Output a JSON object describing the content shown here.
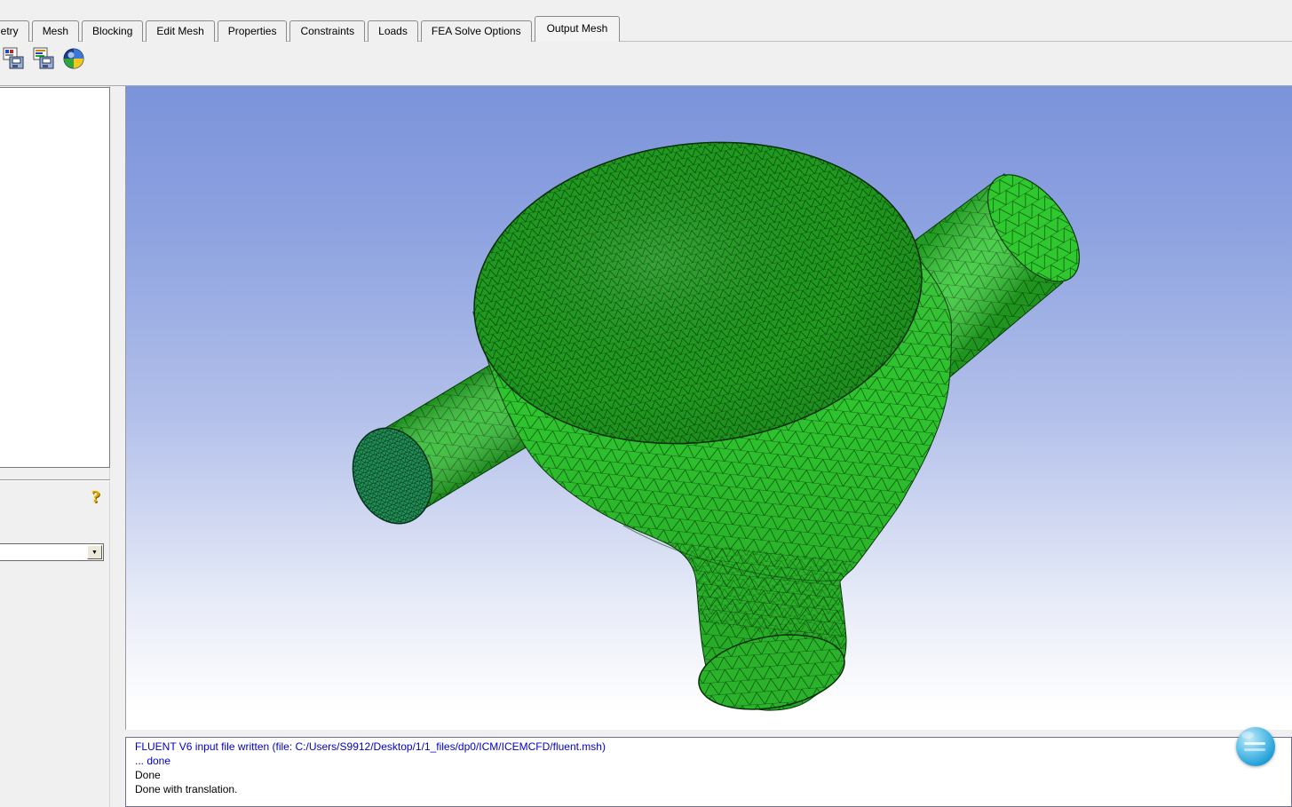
{
  "tabs": {
    "items": [
      {
        "label": "Geometry"
      },
      {
        "label": "Mesh"
      },
      {
        "label": "Blocking"
      },
      {
        "label": "Edit Mesh"
      },
      {
        "label": "Properties"
      },
      {
        "label": "Constraints"
      },
      {
        "label": "Loads"
      },
      {
        "label": "FEA Solve Options"
      },
      {
        "label": "Output Mesh"
      }
    ],
    "active": "Output Mesh"
  },
  "toolbar": {
    "icons": [
      {
        "name": "select-solver-icon"
      },
      {
        "name": "boundary-conditions-icon"
      },
      {
        "name": "write-input-icon"
      }
    ]
  },
  "left_panel": {
    "help_icon_glyph": "?",
    "dropdown": {
      "value": "",
      "arrow_glyph": "▼"
    }
  },
  "viewport": {
    "description": "Green tetrahedral surface mesh of a tee / mixing junction vessel with side pipes",
    "mesh_color": "#2ec52e",
    "top_face_color": "#1f9b1f",
    "background_top": "#7b93da",
    "background_bottom": "#ffffff"
  },
  "log": {
    "lines": [
      {
        "text": "FLUENT V6 input file written (file: C:/Users/S9912/Desktop/1/1_files/dp0/ICM/ICEMCFD/fluent.msh)",
        "color": "#0000cc"
      },
      {
        "text": "... done",
        "color": "#0000cc"
      },
      {
        "text": "Done",
        "color": "#000000"
      },
      {
        "text": "Done with translation.",
        "color": "#000000"
      }
    ]
  }
}
